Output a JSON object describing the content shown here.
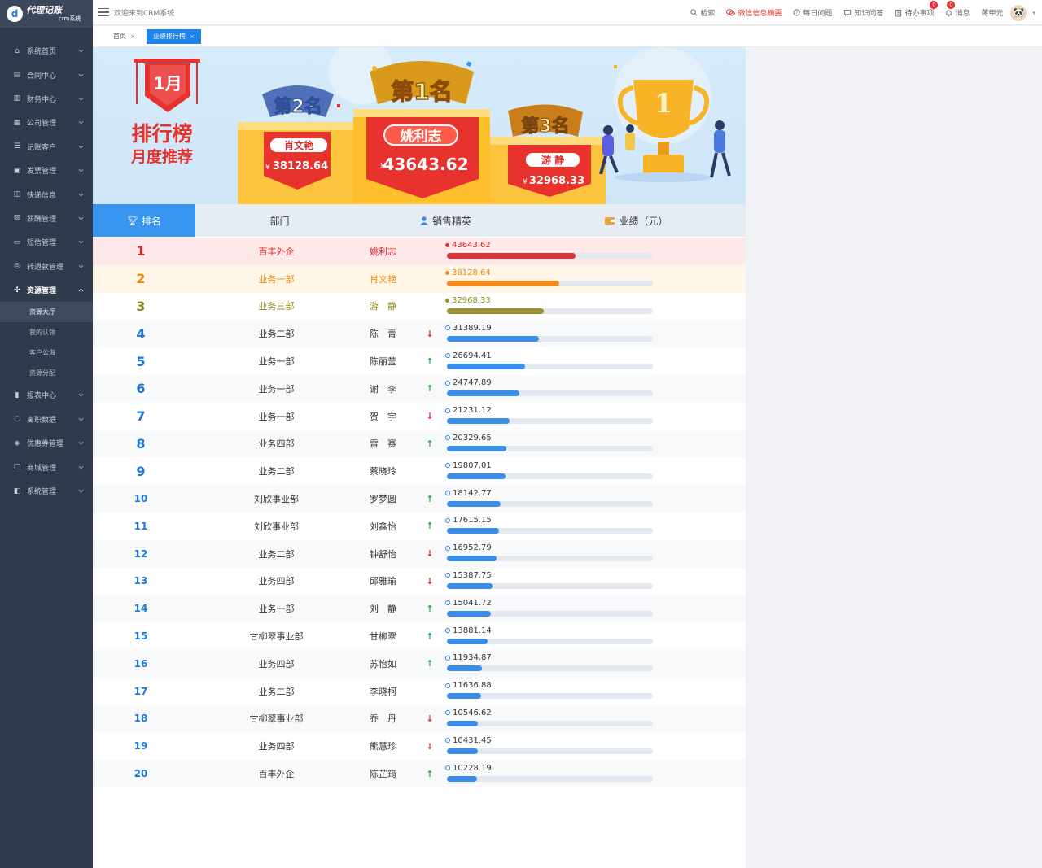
{
  "app": {
    "logo_text": "代理记账",
    "logo_sub": "crm系统",
    "welcome": "欢迎来到CRM系统"
  },
  "sidebar": {
    "items": [
      {
        "label": "系统首页",
        "icon": "home-icon"
      },
      {
        "label": "合同中心",
        "icon": "contract-icon"
      },
      {
        "label": "财务中心",
        "icon": "finance-icon"
      },
      {
        "label": "公司管理",
        "icon": "company-icon"
      },
      {
        "label": "记账客户",
        "icon": "customer-icon"
      },
      {
        "label": "发票管理",
        "icon": "invoice-icon"
      },
      {
        "label": "快递信息",
        "icon": "express-icon"
      },
      {
        "label": "薪酬管理",
        "icon": "salary-icon"
      },
      {
        "label": "短信管理",
        "icon": "sms-icon"
      },
      {
        "label": "转退款管理",
        "icon": "refund-icon"
      },
      {
        "label": "资源管理",
        "icon": "resource-icon"
      },
      {
        "label": "报表中心",
        "icon": "report-icon"
      },
      {
        "label": "离职数据",
        "icon": "resign-icon"
      },
      {
        "label": "优惠券管理",
        "icon": "coupon-icon"
      },
      {
        "label": "商城管理",
        "icon": "mall-icon"
      },
      {
        "label": "系统管理",
        "icon": "settings-icon"
      }
    ],
    "sub_items": [
      "资源大厅",
      "我的认领",
      "客户公海",
      "资源分配"
    ]
  },
  "topbar": {
    "search": "检索",
    "wechat": "微信信息摘要",
    "daily": "每日问题",
    "knowledge": "知识问答",
    "todo": "待办事项",
    "todo_count": "0",
    "message": "消息",
    "message_count": "0",
    "user": "蒋甲元"
  },
  "tabs": [
    "首页",
    "业绩排行榜"
  ],
  "banner": {
    "month": "1月",
    "title1": "排行榜",
    "title2": "月度推荐",
    "trophy_number": "1",
    "podium": [
      {
        "place": "第2名",
        "name": "肖文艳",
        "amount": "38128.64"
      },
      {
        "place": "第1名",
        "name": "姚利志",
        "amount": "43643.62"
      },
      {
        "place": "第3名",
        "name": "游 静",
        "amount": "32968.33"
      }
    ],
    "currency": "¥"
  },
  "table": {
    "headers": {
      "rank": "排名",
      "dept": "部门",
      "sales": "销售精英",
      "perf": "业绩（元）"
    },
    "max_value": 70000,
    "rows": [
      {
        "rank": "1",
        "dept": "百丰外企",
        "name": "姚利志",
        "trend": "",
        "value": "43643.62"
      },
      {
        "rank": "2",
        "dept": "业务一部",
        "name": "肖文艳",
        "trend": "",
        "value": "38128.64"
      },
      {
        "rank": "3",
        "dept": "业务三部",
        "name": "游　静",
        "trend": "",
        "value": "32968.33"
      },
      {
        "rank": "4",
        "dept": "业务二部",
        "name": "陈　青",
        "trend": "down",
        "value": "31389.19"
      },
      {
        "rank": "5",
        "dept": "业务一部",
        "name": "陈丽莹",
        "trend": "up",
        "value": "26694.41"
      },
      {
        "rank": "6",
        "dept": "业务一部",
        "name": "谢　李",
        "trend": "up",
        "value": "24747.89"
      },
      {
        "rank": "7",
        "dept": "业务一部",
        "name": "贺　宇",
        "trend": "down",
        "value": "21231.12"
      },
      {
        "rank": "8",
        "dept": "业务四部",
        "name": "雷　赛",
        "trend": "up",
        "value": "20329.65"
      },
      {
        "rank": "9",
        "dept": "业务二部",
        "name": "蔡晓玲",
        "trend": "",
        "value": "19807.01"
      },
      {
        "rank": "10",
        "dept": "刘欣事业部",
        "name": "罗梦圆",
        "trend": "up",
        "value": "18142.77"
      },
      {
        "rank": "11",
        "dept": "刘欣事业部",
        "name": "刘鑫怡",
        "trend": "up",
        "value": "17615.15"
      },
      {
        "rank": "12",
        "dept": "业务二部",
        "name": "钟舒怡",
        "trend": "down",
        "value": "16952.79"
      },
      {
        "rank": "13",
        "dept": "业务四部",
        "name": "邱雅瑜",
        "trend": "down",
        "value": "15387.75"
      },
      {
        "rank": "14",
        "dept": "业务一部",
        "name": "刘　静",
        "trend": "up",
        "value": "15041.72"
      },
      {
        "rank": "15",
        "dept": "甘柳翠事业部",
        "name": "甘柳翠",
        "trend": "up",
        "value": "13881.14"
      },
      {
        "rank": "16",
        "dept": "业务四部",
        "name": "苏怡如",
        "trend": "up",
        "value": "11934.87"
      },
      {
        "rank": "17",
        "dept": "业务二部",
        "name": "李晓柯",
        "trend": "",
        "value": "11636.88"
      },
      {
        "rank": "18",
        "dept": "甘柳翠事业部",
        "name": "乔　丹",
        "trend": "down",
        "value": "10546.62"
      },
      {
        "rank": "19",
        "dept": "业务四部",
        "name": "熊慧珍",
        "trend": "down",
        "value": "10431.45"
      },
      {
        "rank": "20",
        "dept": "百丰外企",
        "name": "陈芷筠",
        "trend": "up",
        "value": "10228.19"
      }
    ]
  },
  "colors": {
    "rank1": "#e02525",
    "rank2": "#f08a13",
    "rank3": "#8e8a1b",
    "rank1_bg": "#fde9ea",
    "rank2_bg": "#fff6e8",
    "bar1": "#d9353b",
    "bar2": "#f18a1c",
    "bar3": "#9c9030",
    "bar": "#3a8ee9",
    "accent": "#1e82e8",
    "sidebar_bg": "#2f3b4d"
  }
}
